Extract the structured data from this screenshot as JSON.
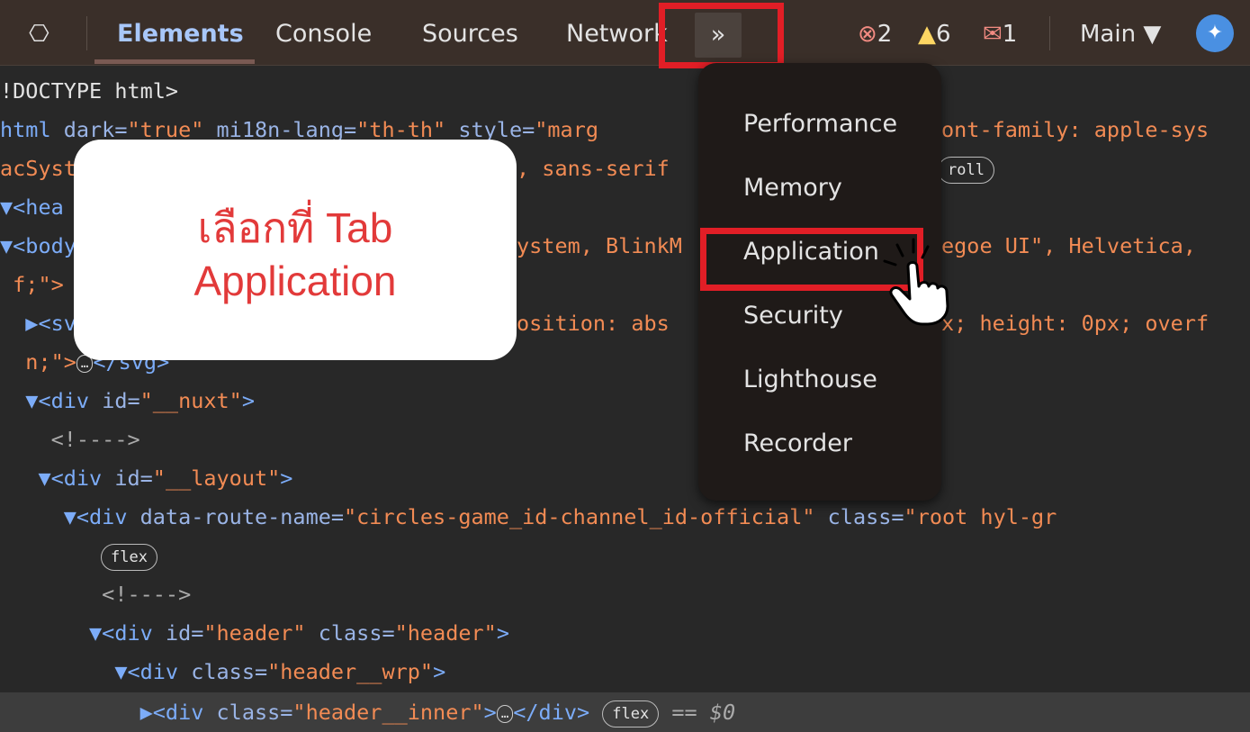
{
  "toolbar": {
    "tabs": [
      {
        "label": "Elements"
      },
      {
        "label": "Console"
      },
      {
        "label": "Sources"
      },
      {
        "label": "Network"
      }
    ],
    "more_tabs_icon": "»",
    "errors": "2",
    "warnings": "6",
    "issues": "1",
    "context": "Main ▼",
    "colors": {
      "error": "#f28b82",
      "warning": "#fdd663",
      "accent": "#a8c7fa",
      "highlight": "#e11e26"
    }
  },
  "menu": {
    "items": [
      "Performance",
      "Memory",
      "Application",
      "Security",
      "Lighthouse",
      "Recorder"
    ]
  },
  "callout": {
    "line1": "เลือกที่ Tab",
    "line2": "Application"
  },
  "code": {
    "doctype": "!DOCTYPE html>",
    "html_line1_tag": "html",
    "html_line1_attrs": " dark=",
    "html_line1_v1": "\"true\"",
    "html_line1_a2": " mi18n-lang=",
    "html_line1_v2": "\"th-th\"",
    "html_line1_a3": " style=",
    "html_line1_v3": "\"marg",
    "html_line1_tail": "ont-family: apple-sys",
    "html_line2_a": "acSyst",
    "html_line2_b": ", sans-serif",
    "html_line2_pill": "roll",
    "head": "▼<hea",
    "body_a": "▼<body",
    "body_b": "ystem, BlinkM",
    "body_c": "egoe UI\", Helvetica,",
    "body_d": " f;\">",
    "svg_a": "  ▶<sv",
    "svg_b": "osition: abs",
    "svg_c": "x; height: 0px; overf",
    "svg_d": "  n;\">",
    "svg_e": "</svg>",
    "nuxt_tag": "  ▼<div ",
    "nuxt_attr": "id=",
    "nuxt_val": "\"__nuxt\"",
    "nuxt_end": ">",
    "comment1": "    <!---->",
    "layout_tag": "   ▼<div ",
    "layout_attr": "id=",
    "layout_val": "\"__layout\"",
    "layout_end": ">",
    "route_tag": "     ▼<div ",
    "route_attr": "data-route-name=",
    "route_val": "\"circles-game_id-channel_id-official\"",
    "route_attr2": " class=",
    "route_val2": "\"root hyl-gr",
    "flex": "flex",
    "comment2": "        <!---->",
    "header_tag": "       ▼<div ",
    "header_attr": "id=",
    "header_val": "\"header\"",
    "header_attr2": " class=",
    "header_val2": "\"header\"",
    "header_end": ">",
    "wrp_tag": "         ▼<div ",
    "wrp_attr": "class=",
    "wrp_val": "\"header__wrp\"",
    "wrp_end": ">",
    "inner_tag": "           ▶<div ",
    "inner_attr": "class=",
    "inner_val": "\"header__inner\"",
    "inner_end": ">",
    "inner_close": "</div>",
    "inner_eq": " == $0",
    "ellipsis": "…"
  }
}
